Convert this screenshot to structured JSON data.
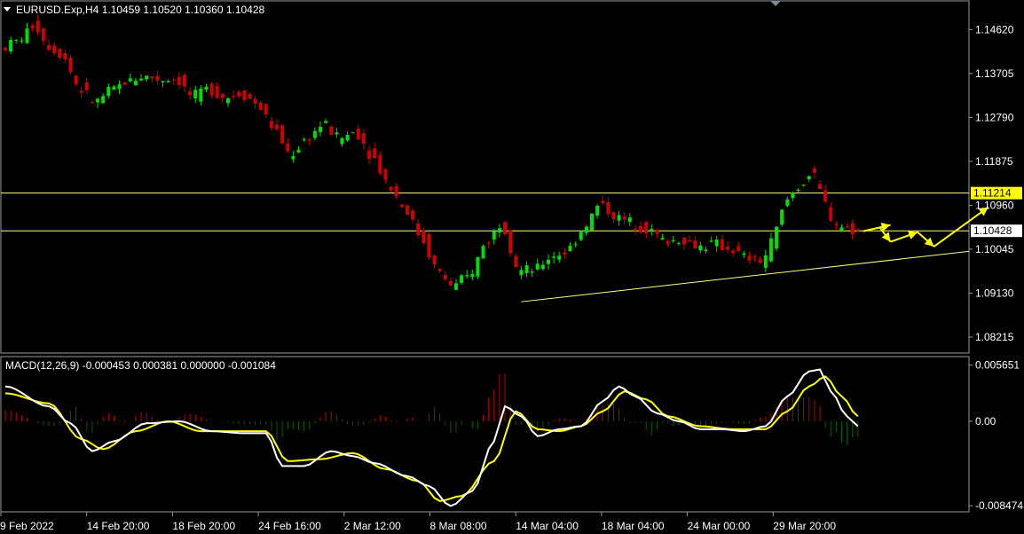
{
  "window": {
    "title": "EURUSD.Exp,H4  1.10459 1.10520 1.10360 1.10428"
  },
  "colors": {
    "background": "#000000",
    "bull": "#00e000",
    "bear": "#d00000",
    "macd_line": "#ffffff",
    "signal_line": "#ffff00",
    "hist_pos": "#c00000",
    "hist_neg": "#006000",
    "level_line": "#ffff7a",
    "arrow": "#ffff00"
  },
  "chart_data": [
    {
      "type": "candlestick",
      "symbol": "EURUSD.Exp",
      "timeframe": "H4",
      "ohlc_header": {
        "open": 1.10459,
        "high": 1.1052,
        "low": 1.1036,
        "close": 1.10428
      },
      "ylim": [
        1.079,
        1.152
      ],
      "y_ticks": [
        "1.14620",
        "1.13705",
        "1.12790",
        "1.11875",
        "1.10960",
        "1.10045",
        "1.09130",
        "1.08215"
      ],
      "x_ticks": [
        "9 Feb 2022",
        "14 Feb 20:00",
        "18 Feb 20:00",
        "24 Feb 16:00",
        "2 Mar 12:00",
        "8 Mar 08:00",
        "14 Mar 04:00",
        "18 Mar 04:00",
        "24 Mar 00:00",
        "29 Mar 20:00"
      ],
      "levels": [
        {
          "price": 1.11214,
          "label": "1.11214",
          "label_bg": "#ffff00"
        },
        {
          "price": 1.10428,
          "label": "1.10428",
          "label_bg": "#ffffff"
        }
      ],
      "trendline": {
        "from": {
          "bar": 95,
          "price": 1.0895
        },
        "to": {
          "bar": 182,
          "price": 1.1
        }
      },
      "forecast_arrows": [
        [
          {
            "bar": 158,
            "price": 1.1042
          },
          {
            "bar": 163,
            "price": 1.1055
          }
        ],
        [
          {
            "bar": 161,
            "price": 1.105
          },
          {
            "bar": 163,
            "price": 1.102
          }
        ],
        [
          {
            "bar": 163,
            "price": 1.102
          },
          {
            "bar": 168,
            "price": 1.104
          }
        ],
        [
          {
            "bar": 168,
            "price": 1.104
          },
          {
            "bar": 171,
            "price": 1.101
          }
        ],
        [
          {
            "bar": 171,
            "price": 1.101
          },
          {
            "bar": 181,
            "price": 1.1092
          }
        ]
      ],
      "anchors": [
        [
          0,
          1.1425
        ],
        [
          3,
          1.144
        ],
        [
          6,
          1.1475
        ],
        [
          8,
          1.143
        ],
        [
          11,
          1.141
        ],
        [
          14,
          1.134
        ],
        [
          17,
          1.131
        ],
        [
          20,
          1.1335
        ],
        [
          23,
          1.1355
        ],
        [
          26,
          1.1365
        ],
        [
          29,
          1.1358
        ],
        [
          32,
          1.136
        ],
        [
          35,
          1.132
        ],
        [
          38,
          1.134
        ],
        [
          41,
          1.132
        ],
        [
          44,
          1.133
        ],
        [
          47,
          1.1305
        ],
        [
          50,
          1.1255
        ],
        [
          53,
          1.12
        ],
        [
          56,
          1.1235
        ],
        [
          59,
          1.1265
        ],
        [
          62,
          1.1235
        ],
        [
          65,
          1.125
        ],
        [
          68,
          1.12
        ],
        [
          71,
          1.114
        ],
        [
          74,
          1.109
        ],
        [
          77,
          1.103
        ],
        [
          80,
          1.096
        ],
        [
          83,
          1.0925
        ],
        [
          86,
          1.095
        ],
        [
          89,
          1.102
        ],
        [
          92,
          1.106
        ],
        [
          95,
          1.096
        ],
        [
          98,
          1.096
        ],
        [
          101,
          1.099
        ],
        [
          104,
          1.1
        ],
        [
          107,
          1.105
        ],
        [
          110,
          1.11
        ],
        [
          113,
          1.107
        ],
        [
          116,
          1.106
        ],
        [
          119,
          1.1045
        ],
        [
          122,
          1.102
        ],
        [
          125,
          1.1025
        ],
        [
          128,
          1.101
        ],
        [
          131,
          1.1015
        ],
        [
          134,
          1.1005
        ],
        [
          137,
          1.0985
        ],
        [
          140,
          1.098
        ],
        [
          142,
          1.103
        ],
        [
          144,
          1.11
        ],
        [
          146,
          1.113
        ],
        [
          148,
          1.115
        ],
        [
          149,
          1.1165
        ],
        [
          151,
          1.111
        ],
        [
          153,
          1.106
        ],
        [
          155,
          1.105
        ],
        [
          157,
          1.1043
        ]
      ],
      "series_bars": 158
    },
    {
      "type": "macd",
      "title": "MACD(12,26,9) -0.000453 0.000381 0.000000 -0.001084",
      "ylim": [
        -0.009,
        0.0064
      ],
      "y_ticks": [
        "0.005651",
        "0.00",
        "-0.008474"
      ],
      "y_tick_values": [
        0.005651,
        0.0,
        -0.008474
      ],
      "macd_anchors": [
        [
          0,
          0.0035
        ],
        [
          8,
          0.0015
        ],
        [
          12,
          -0.0002
        ],
        [
          16,
          -0.003
        ],
        [
          20,
          -0.002
        ],
        [
          26,
          -0.0002
        ],
        [
          32,
          0.0
        ],
        [
          38,
          -0.001
        ],
        [
          44,
          -0.0012
        ],
        [
          48,
          -0.0012
        ],
        [
          51,
          -0.0045
        ],
        [
          55,
          -0.0045
        ],
        [
          60,
          -0.003
        ],
        [
          64,
          -0.0035
        ],
        [
          68,
          -0.0042
        ],
        [
          74,
          -0.0055
        ],
        [
          78,
          -0.0065
        ],
        [
          82,
          -0.0085
        ],
        [
          86,
          -0.007
        ],
        [
          90,
          -0.002
        ],
        [
          92,
          0.0015
        ],
        [
          95,
          0.0005
        ],
        [
          98,
          -0.0015
        ],
        [
          102,
          -0.0008
        ],
        [
          106,
          -0.0005
        ],
        [
          110,
          0.002
        ],
        [
          113,
          0.0035
        ],
        [
          116,
          0.0025
        ],
        [
          120,
          0.0008
        ],
        [
          124,
          0.0
        ],
        [
          128,
          -0.0008
        ],
        [
          132,
          -0.0008
        ],
        [
          136,
          -0.001
        ],
        [
          140,
          -0.0005
        ],
        [
          144,
          0.0025
        ],
        [
          148,
          0.005
        ],
        [
          150,
          0.0052
        ],
        [
          152,
          0.003
        ],
        [
          155,
          0.0005
        ],
        [
          157,
          -0.0005
        ]
      ],
      "signal_anchors": [
        [
          0,
          0.0028
        ],
        [
          8,
          0.0018
        ],
        [
          14,
          -0.0018
        ],
        [
          18,
          -0.0028
        ],
        [
          24,
          -0.001
        ],
        [
          30,
          0.0
        ],
        [
          36,
          -0.001
        ],
        [
          44,
          -0.001
        ],
        [
          48,
          -0.001
        ],
        [
          52,
          -0.004
        ],
        [
          58,
          -0.0038
        ],
        [
          64,
          -0.0032
        ],
        [
          70,
          -0.0048
        ],
        [
          76,
          -0.006
        ],
        [
          80,
          -0.008
        ],
        [
          84,
          -0.0075
        ],
        [
          90,
          -0.004
        ],
        [
          94,
          0.001
        ],
        [
          98,
          -0.0008
        ],
        [
          102,
          -0.001
        ],
        [
          106,
          -0.0005
        ],
        [
          110,
          0.001
        ],
        [
          114,
          0.003
        ],
        [
          118,
          0.0022
        ],
        [
          122,
          0.0005
        ],
        [
          128,
          -0.0005
        ],
        [
          134,
          -0.0008
        ],
        [
          140,
          -0.0008
        ],
        [
          144,
          0.001
        ],
        [
          148,
          0.0035
        ],
        [
          151,
          0.0045
        ],
        [
          154,
          0.0025
        ],
        [
          157,
          0.0005
        ]
      ]
    }
  ]
}
